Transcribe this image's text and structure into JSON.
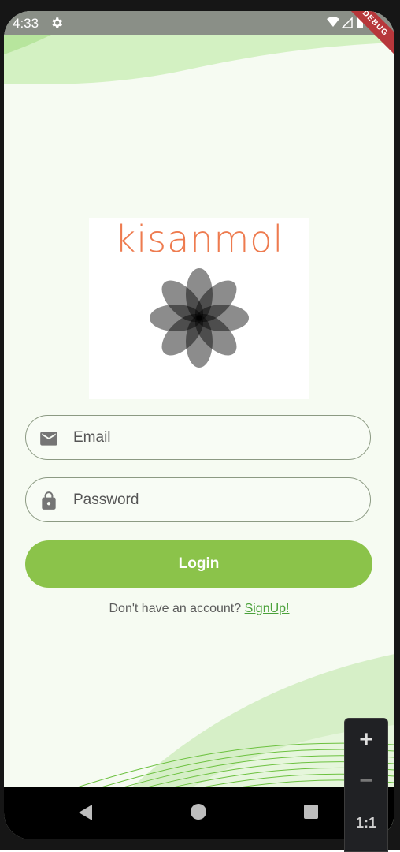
{
  "status_bar": {
    "time": "4:33",
    "debug_banner": "DEBUG"
  },
  "logo": {
    "text": "kisanmol"
  },
  "form": {
    "email_placeholder": "Email",
    "password_placeholder": "Password",
    "login_label": "Login"
  },
  "signup": {
    "prompt": "Don't have an account?",
    "link": "SignUp!"
  },
  "zoom_controls": {
    "plus": "+",
    "minus": "−",
    "reset": "1:1"
  },
  "colors": {
    "accent_green": "#8bc34a",
    "logo_orange": "#ee7b4f",
    "link_green": "#4aa13a"
  },
  "icons": [
    "settings-gear-icon",
    "wifi-icon",
    "signal-icon",
    "battery-icon",
    "mail-icon",
    "lock-icon",
    "nav-back-icon",
    "nav-home-icon",
    "nav-recents-icon",
    "flower-logo-icon"
  ]
}
